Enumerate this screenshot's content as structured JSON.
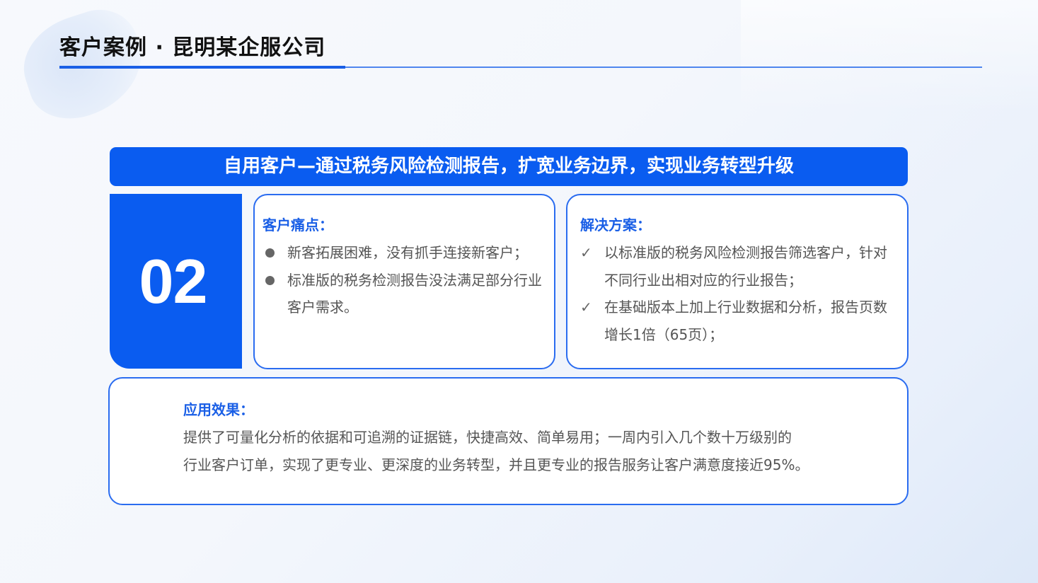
{
  "title": "客户案例 · 昆明某企服公司",
  "banner": "自用客户—通过税务风险检测报告，扩宽业务边界，实现业务转型升级",
  "case_number": "02",
  "pain_points": {
    "heading": "客户痛点：",
    "items": [
      "新客拓展困难，没有抓手连接新客户；",
      "标准版的税务检测报告没法满足部分行业客户需求。"
    ],
    "bullet_icon": "bullet-dot-icon"
  },
  "solution": {
    "heading": "解决方案：",
    "items": [
      "以标准版的税务风险检测报告筛选客户，针对不同行业出相对应的行业报告；",
      "在基础版本上加上行业数据和分析，报告页数增长1倍（65页）；"
    ],
    "bullet_icon": "checkmark-icon",
    "bullet_glyph": "✓"
  },
  "effect": {
    "heading": "应用效果：",
    "lines": [
      "提供了可量化分析的依据和可追溯的证据链，快捷高效、简单易用；一周内引入几个数十万级别的",
      "行业客户订单，实现了更专业、更深度的业务转型，并且更专业的报告服务让客户满意度接近95%。"
    ]
  },
  "colors": {
    "accent": "#0a5cf0",
    "heading": "#1a5fe6",
    "body_text": "#555555",
    "title_text": "#111111"
  }
}
